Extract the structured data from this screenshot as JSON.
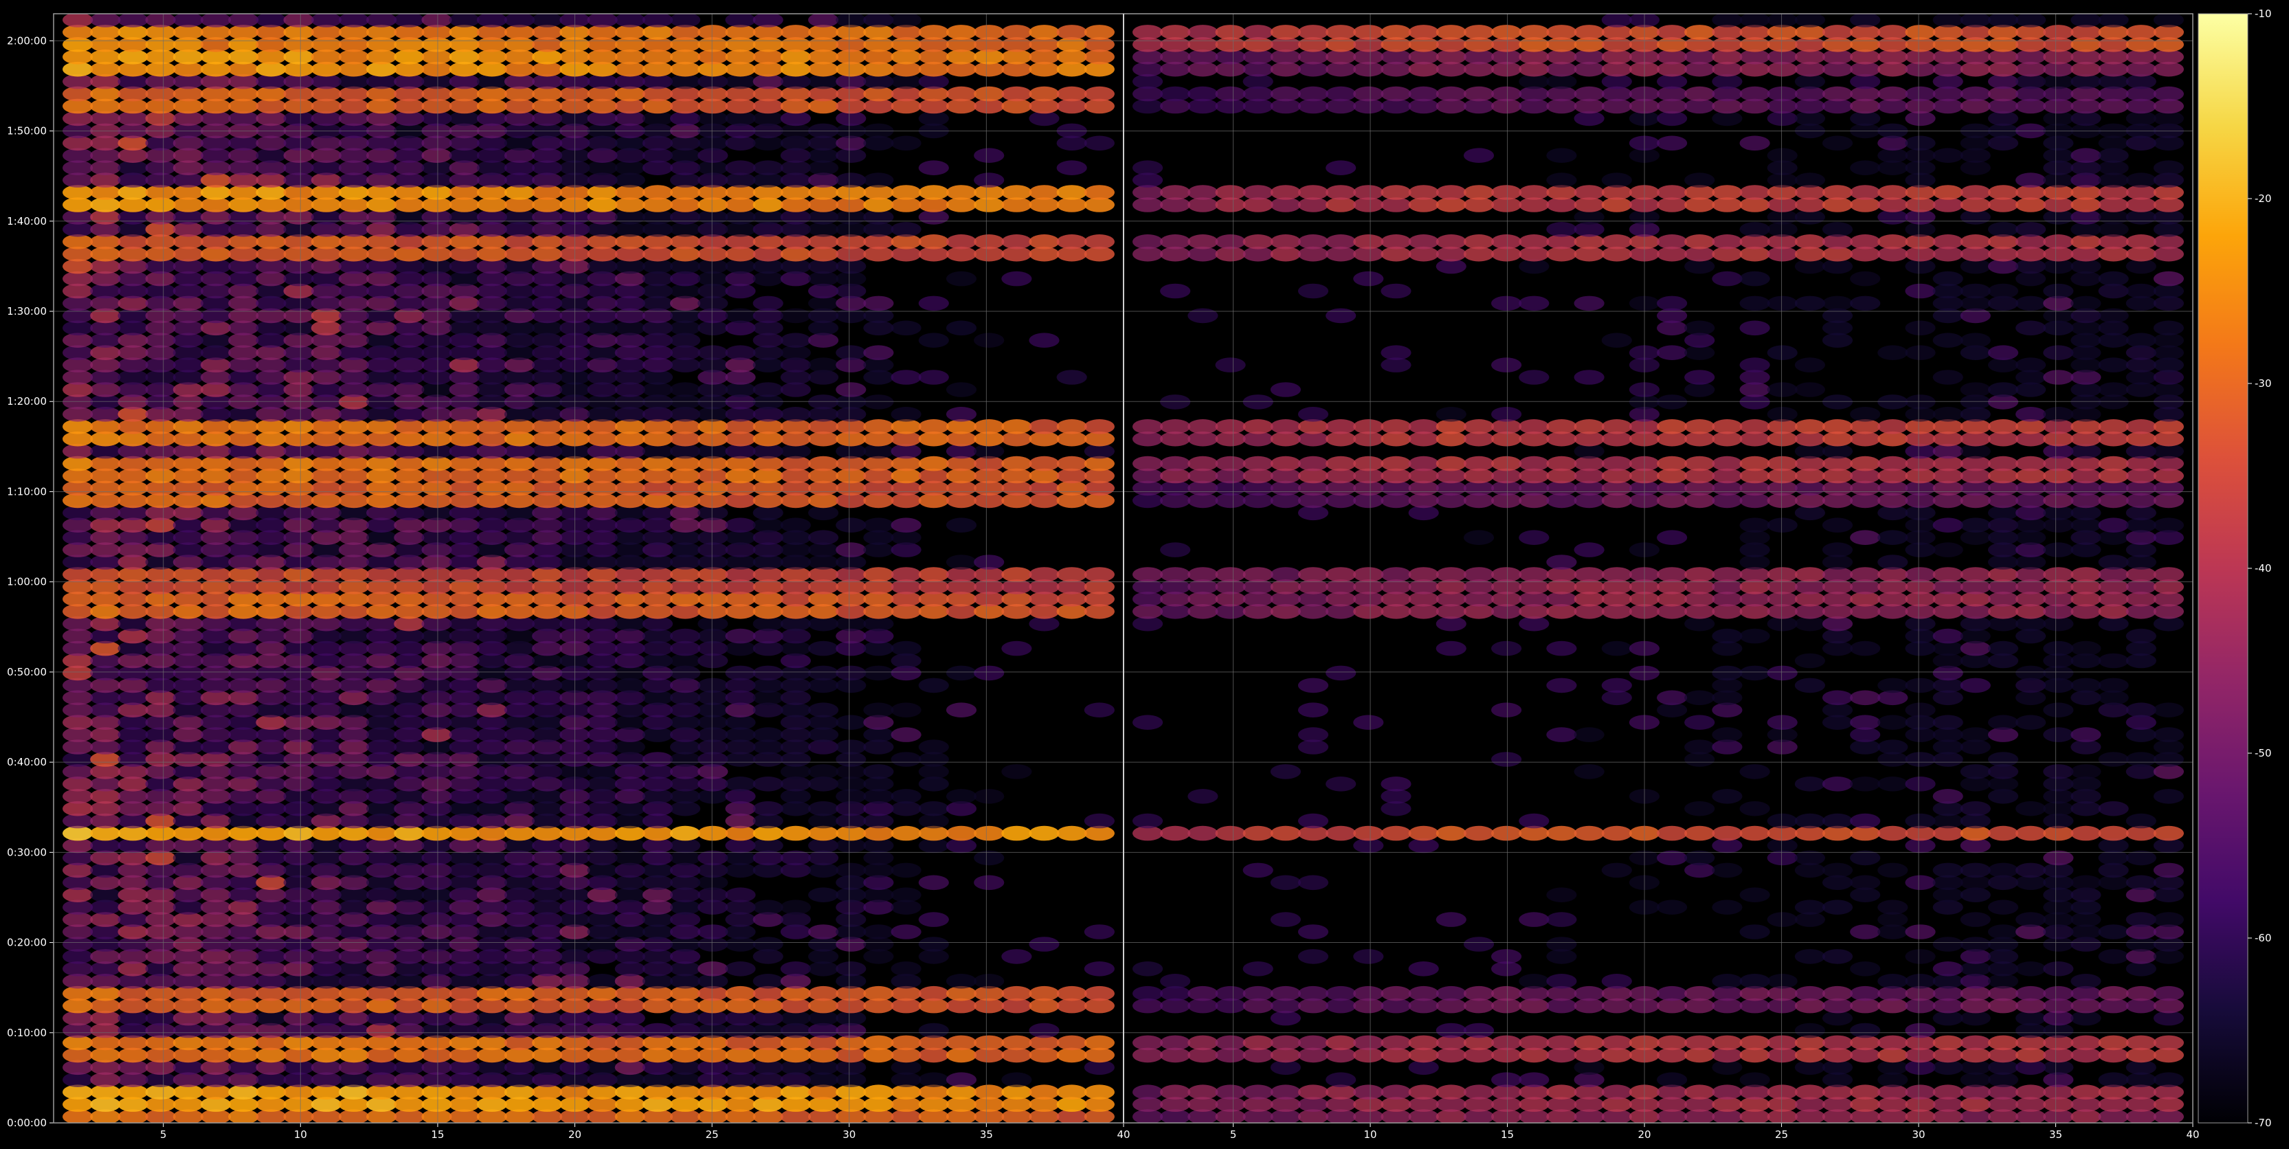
{
  "chart_data": {
    "type": "heatmap",
    "title": "",
    "xlabel": "",
    "ylabel": "",
    "grid": true,
    "background": "#000000",
    "grid_color": "#6e6e6e",
    "colormap": "inferno",
    "colorbar": {
      "position": "right",
      "range": [
        -70,
        -10
      ],
      "ticks": [
        "-10",
        "-20",
        "-30",
        "-40",
        "-50",
        "-60",
        "-70"
      ]
    },
    "panels": [
      {
        "name": "",
        "xlim": [
          1,
          40
        ],
        "xticks": [
          "5",
          "10",
          "15",
          "20",
          "25",
          "30",
          "35",
          "40"
        ],
        "channels": 38
      },
      {
        "name": "",
        "xlim": [
          40,
          79
        ],
        "xticks": [
          "5",
          "10",
          "15",
          "20",
          "25",
          "30",
          "35",
          "40"
        ],
        "channels": 38
      }
    ],
    "y_axis": {
      "unit": "time",
      "range_seconds": [
        0,
        7380
      ],
      "ticks": [
        "0:00:00",
        "0:10:00",
        "0:20:00",
        "0:30:00",
        "0:40:00",
        "0:50:00",
        "1:00:00",
        "1:10:00",
        "1:20:00",
        "1:30:00",
        "1:40:00",
        "1:50:00",
        "2:00:00"
      ]
    },
    "time_rows": 90,
    "hot_rows": [
      {
        "time": "2:00:00",
        "left_db": -22,
        "right_db": -30
      },
      {
        "time": "1:58:00",
        "left_db": -20,
        "right_db": -42
      },
      {
        "time": "1:53:00",
        "left_db": -26,
        "right_db": -48
      },
      {
        "time": "1:43:00",
        "left_db": -20,
        "right_db": -34
      },
      {
        "time": "1:37:00",
        "left_db": -28,
        "right_db": -36
      },
      {
        "time": "1:17:00",
        "left_db": -24,
        "right_db": -34
      },
      {
        "time": "1:12:00",
        "left_db": -24,
        "right_db": -36
      },
      {
        "time": "1:10:00",
        "left_db": -26,
        "right_db": -46
      },
      {
        "time": "1:00:00",
        "left_db": -30,
        "right_db": -40
      },
      {
        "time": "0:57:00",
        "left_db": -26,
        "right_db": -40
      },
      {
        "time": "0:32:00",
        "left_db": -18,
        "right_db": -30
      },
      {
        "time": "0:14:00",
        "left_db": -26,
        "right_db": -46
      },
      {
        "time": "0:08:00",
        "left_db": -24,
        "right_db": -36
      },
      {
        "time": "0:03:00",
        "left_db": -18,
        "right_db": -38
      },
      {
        "time": "0:00:00",
        "left_db": -24,
        "right_db": -40
      }
    ]
  }
}
